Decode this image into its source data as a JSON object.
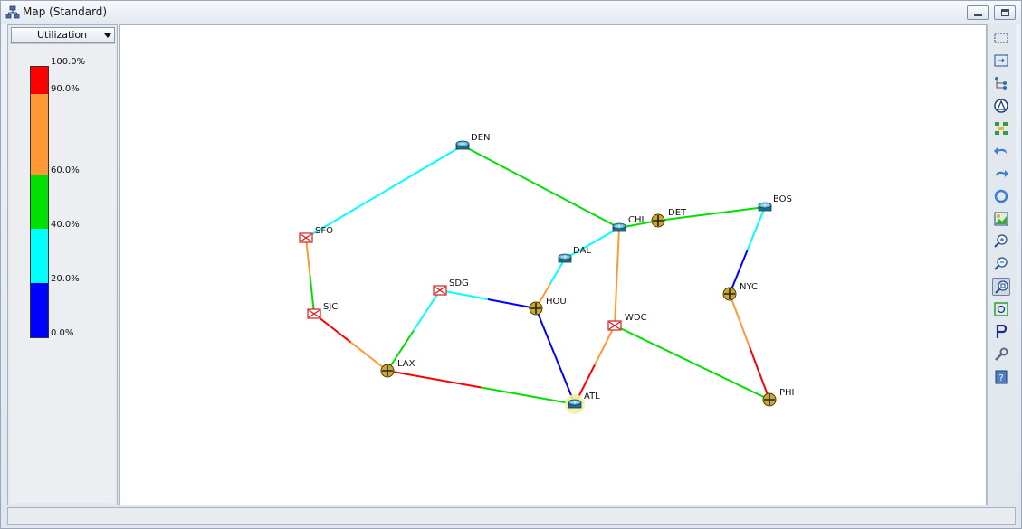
{
  "window": {
    "title": "Map (Standard)",
    "controls": [
      "minimize",
      "maximize"
    ]
  },
  "legend": {
    "selector_value": "Utilization",
    "ticks": [
      "100.0%",
      "90.0%",
      "60.0%",
      "40.0%",
      "20.0%",
      "0.0%"
    ],
    "bands": [
      {
        "from": 90,
        "to": 100,
        "color": "#ff0000"
      },
      {
        "from": 60,
        "to": 90,
        "color": "#ff9933"
      },
      {
        "from": 40,
        "to": 60,
        "color": "#00e000"
      },
      {
        "from": 20,
        "to": 40,
        "color": "#00ffff"
      },
      {
        "from": 0,
        "to": 20,
        "color": "#0000ff"
      }
    ]
  },
  "map": {
    "nodes": [
      {
        "id": "DEN",
        "label": "DEN",
        "kind": "router"
      },
      {
        "id": "SFO",
        "label": "SFO",
        "kind": "bowtie"
      },
      {
        "id": "SJC",
        "label": "SJC",
        "kind": "bowtie"
      },
      {
        "id": "SDG",
        "label": "SDG",
        "kind": "bowtie"
      },
      {
        "id": "LAX",
        "label": "LAX",
        "kind": "cross"
      },
      {
        "id": "HOU",
        "label": "HOU",
        "kind": "cross"
      },
      {
        "id": "DAL",
        "label": "DAL",
        "kind": "router"
      },
      {
        "id": "ATL",
        "label": "ATL",
        "kind": "router",
        "highlighted": true
      },
      {
        "id": "CHI",
        "label": "CHI",
        "kind": "router"
      },
      {
        "id": "DET",
        "label": "DET",
        "kind": "cross"
      },
      {
        "id": "WDC",
        "label": "WDC",
        "kind": "bowtie"
      },
      {
        "id": "BOS",
        "label": "BOS",
        "kind": "router"
      },
      {
        "id": "NYC",
        "label": "NYC",
        "kind": "cross"
      },
      {
        "id": "PHI",
        "label": "PHI",
        "kind": "cross"
      }
    ],
    "links": [
      {
        "a": "DEN",
        "b": "SFO",
        "color_a": "#00ffff",
        "color_b": "#00ffff"
      },
      {
        "a": "DEN",
        "b": "CHI",
        "color_a": "#00e000",
        "color_b": "#00e000"
      },
      {
        "a": "SFO",
        "b": "SJC",
        "color_a": "#ff9933",
        "color_b": "#00e000"
      },
      {
        "a": "SJC",
        "b": "LAX",
        "color_a": "#ff0000",
        "color_b": "#ff9933"
      },
      {
        "a": "LAX",
        "b": "SDG",
        "color_a": "#00e000",
        "color_b": "#00ffff"
      },
      {
        "a": "LAX",
        "b": "ATL",
        "color_a": "#ff0000",
        "color_b": "#00e000"
      },
      {
        "a": "SDG",
        "b": "HOU",
        "color_a": "#00ffff",
        "color_b": "#0000ff"
      },
      {
        "a": "HOU",
        "b": "DAL",
        "color_a": "#ff9933",
        "color_b": "#00ffff"
      },
      {
        "a": "HOU",
        "b": "ATL",
        "color_a": "#0000ff",
        "color_b": "#0000ff"
      },
      {
        "a": "DAL",
        "b": "CHI",
        "color_a": "#00ffff",
        "color_b": "#00ffff"
      },
      {
        "a": "CHI",
        "b": "WDC",
        "color_a": "#ff9933",
        "color_b": "#ff9933"
      },
      {
        "a": "CHI",
        "b": "DET",
        "color_a": "#00e000",
        "color_b": "#00e000"
      },
      {
        "a": "DET",
        "b": "BOS",
        "color_a": "#00e000",
        "color_b": "#00e000"
      },
      {
        "a": "WDC",
        "b": "ATL",
        "color_a": "#ff9933",
        "color_b": "#ff0000"
      },
      {
        "a": "WDC",
        "b": "PHI",
        "color_a": "#00e000",
        "color_b": "#00e000"
      },
      {
        "a": "BOS",
        "b": "NYC",
        "color_a": "#00ffff",
        "color_b": "#0000ff"
      },
      {
        "a": "NYC",
        "b": "PHI",
        "color_a": "#ff9933",
        "color_b": "#ff0000"
      }
    ]
  },
  "toolbar": {
    "tools": [
      {
        "name": "select-all-icon"
      },
      {
        "name": "refresh-layout-icon"
      },
      {
        "name": "tree-layout-icon"
      },
      {
        "name": "route-icon"
      },
      {
        "name": "grid-layout-icon"
      },
      {
        "name": "undo-icon"
      },
      {
        "name": "redo-icon"
      },
      {
        "name": "reset-icon"
      },
      {
        "name": "background-image-icon"
      },
      {
        "name": "zoom-in-icon"
      },
      {
        "name": "zoom-out-icon"
      },
      {
        "name": "zoom-fit-icon",
        "active": true
      },
      {
        "name": "fit-selection-icon"
      },
      {
        "name": "properties-icon"
      },
      {
        "name": "tools-icon"
      },
      {
        "name": "help-icon"
      }
    ]
  }
}
